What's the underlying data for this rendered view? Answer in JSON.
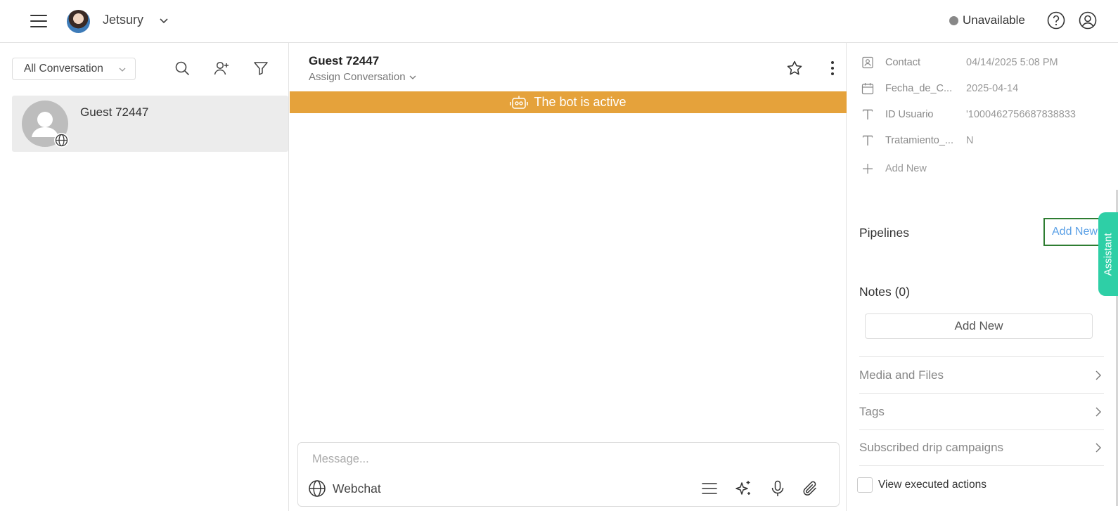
{
  "topbar": {
    "workspace": "Jetsury",
    "status": "Unavailable",
    "status_color": "#888888"
  },
  "left": {
    "filter": "All Conversation",
    "conversations": [
      {
        "name": "Guest 72447",
        "channel_icon": "globe-icon"
      }
    ]
  },
  "chat": {
    "title": "Guest 72447",
    "assign": "Assign Conversation",
    "banner": "The bot is active",
    "banner_color": "#e5a23b",
    "composer": {
      "placeholder": "Message...",
      "channel": "Webchat"
    }
  },
  "details": {
    "attributes": [
      {
        "icon": "contact-card-icon",
        "label": "Contact",
        "value": "04/14/2025 5:08 PM"
      },
      {
        "icon": "calendar-icon",
        "label": "Fecha_de_C...",
        "value": "2025-04-14"
      },
      {
        "icon": "text-type-icon",
        "label": "ID Usuario",
        "value": "'1000462756687838833"
      },
      {
        "icon": "text-type-icon",
        "label": "Tratamiento_...",
        "value": "N"
      }
    ],
    "add_new_attr": "Add New",
    "pipelines": {
      "title": "Pipelines",
      "add": "Add New"
    },
    "notes": {
      "title": "Notes (0)",
      "add": "Add New"
    },
    "sections": [
      "Media and Files",
      "Tags",
      "Subscribed drip campaigns"
    ],
    "executed": "View executed actions"
  },
  "assistant": "Assistant"
}
